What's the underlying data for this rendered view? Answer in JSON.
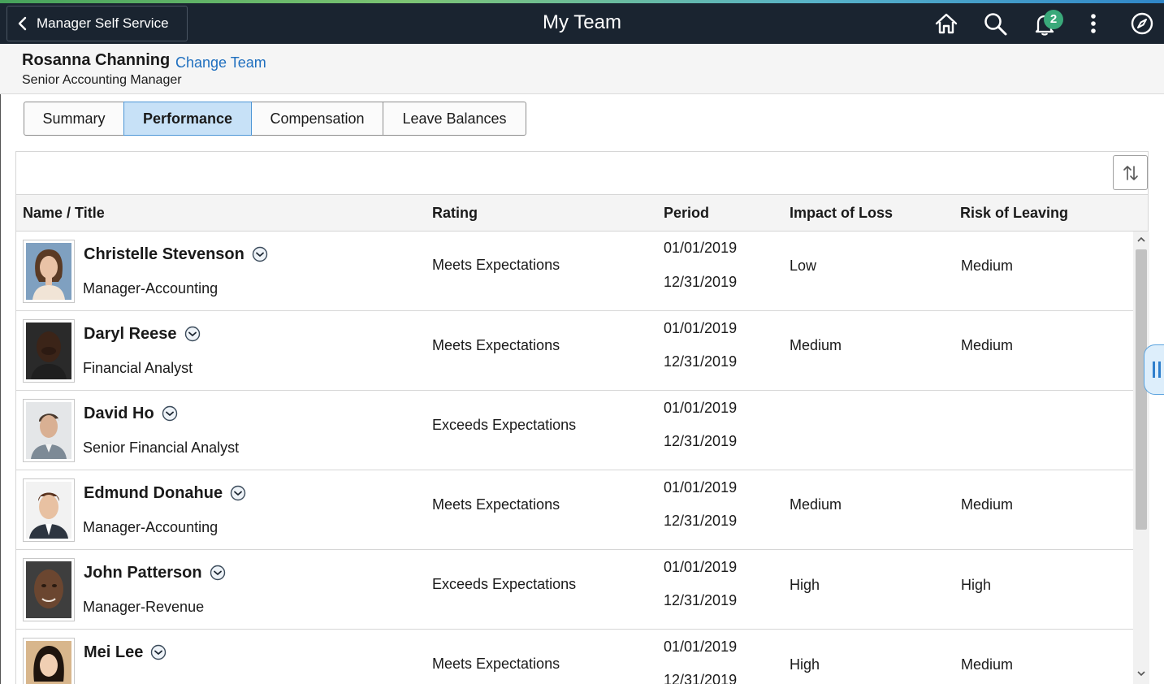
{
  "banner": {
    "back_label": "Manager Self Service",
    "title": "My Team",
    "notification_count": "2",
    "icons": [
      "home-icon",
      "search-icon",
      "bell-icon",
      "more-vertical-icon",
      "navbar-compass-icon"
    ]
  },
  "header": {
    "manager_name": "Rosanna Channing",
    "change_team_label": "Change Team",
    "manager_title": "Senior Accounting Manager"
  },
  "tabs": [
    {
      "label": "Summary",
      "active": false
    },
    {
      "label": "Performance",
      "active": true
    },
    {
      "label": "Compensation",
      "active": false
    },
    {
      "label": "Leave Balances",
      "active": false
    }
  ],
  "grid": {
    "columns": [
      "Name / Title",
      "Rating",
      "Period",
      "Impact of Loss",
      "Risk of Leaving"
    ],
    "rows": [
      {
        "name": "Christelle Stevenson",
        "title": "Manager-Accounting",
        "rating": "Meets Expectations",
        "period_start": "01/01/2019",
        "period_end": "12/31/2019",
        "impact": "Low",
        "risk": "Medium"
      },
      {
        "name": "Daryl Reese",
        "title": "Financial Analyst",
        "rating": "Meets Expectations",
        "period_start": "01/01/2019",
        "period_end": "12/31/2019",
        "impact": "Medium",
        "risk": "Medium"
      },
      {
        "name": "David Ho",
        "title": "Senior Financial Analyst",
        "rating": "Exceeds Expectations",
        "period_start": "01/01/2019",
        "period_end": "12/31/2019",
        "impact": "",
        "risk": ""
      },
      {
        "name": "Edmund Donahue",
        "title": "Manager-Accounting",
        "rating": "Meets Expectations",
        "period_start": "01/01/2019",
        "period_end": "12/31/2019",
        "impact": "Medium",
        "risk": "Medium"
      },
      {
        "name": "John Patterson",
        "title": "Manager-Revenue",
        "rating": "Exceeds Expectations",
        "period_start": "01/01/2019",
        "period_end": "12/31/2019",
        "impact": "High",
        "risk": "High"
      },
      {
        "name": "Mei Lee",
        "title": "",
        "rating": "Meets Expectations",
        "period_start": "01/01/2019",
        "period_end": "12/31/2019",
        "impact": "High",
        "risk": "Medium"
      }
    ]
  },
  "colors": {
    "banner_bg": "#1a2430",
    "active_tab_bg": "#c7e1f7",
    "link": "#1f6fbf",
    "badge": "#3aa97a"
  }
}
